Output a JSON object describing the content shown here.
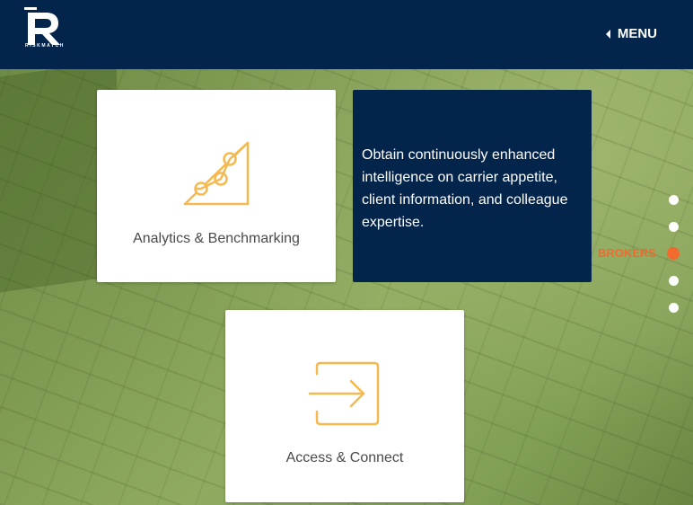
{
  "header": {
    "logo_letter": "R",
    "logo_sub": "RISKMATCH",
    "menu_label": "MENU"
  },
  "cards": {
    "analytics_label": "Analytics & Benchmarking",
    "access_label": "Access & Connect"
  },
  "description": {
    "text": "Obtain continuously enhanced intelligence on carrier appetite, client information, and colleague expertise."
  },
  "nav_dots": {
    "active_label": "BROKERS"
  },
  "colors": {
    "header_bg": "#03254c",
    "accent_orange": "#f26a2e",
    "icon_gold": "#f5b94f",
    "card_bg": "#ffffff"
  }
}
